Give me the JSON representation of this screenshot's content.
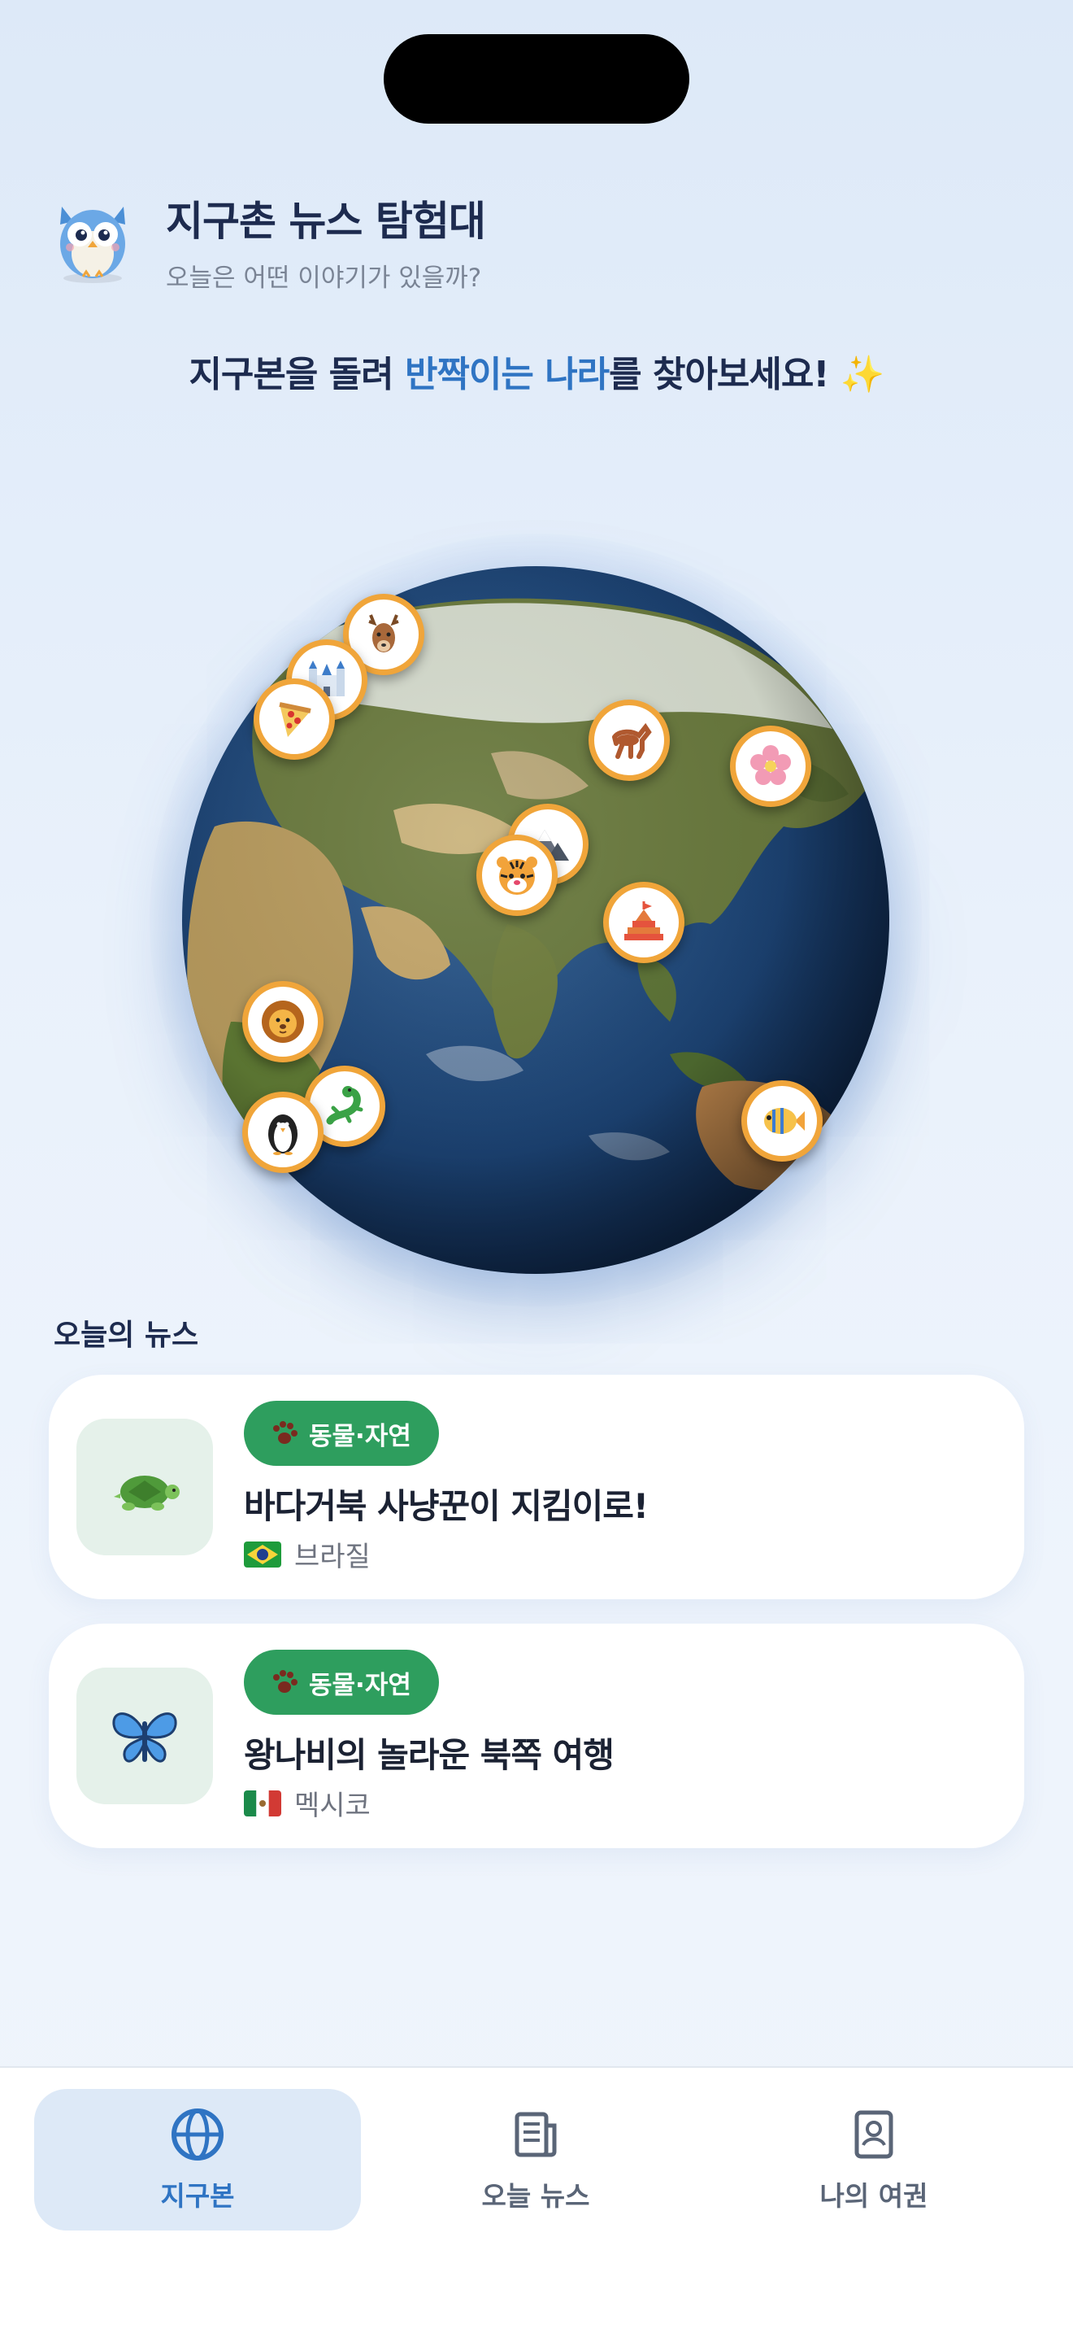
{
  "header": {
    "title": "지구촌 뉴스 탐험대",
    "subtitle": "오늘은 어떤 이야기가 있을까?"
  },
  "headline": {
    "part1": "지구본을 돌려 ",
    "highlight": "반짝이는 나라",
    "part2": "를 찾아보세요! ",
    "emoji": "✨"
  },
  "globe": {
    "markers": [
      "deer",
      "castle",
      "pizza",
      "horse",
      "cherry-blossom",
      "mountain",
      "tiger",
      "pagoda",
      "lion",
      "lizard",
      "penguin",
      "tropical-fish"
    ]
  },
  "news": {
    "section_title": "오늘의 뉴스",
    "items": [
      {
        "category": "동물·자연",
        "title": "바다거북 사냥꾼이 지킴이로!",
        "country": "브라질",
        "icon": "turtle-icon"
      },
      {
        "category": "동물·자연",
        "title": "왕나비의 놀라운 북쪽 여행",
        "country": "멕시코",
        "icon": "butterfly-icon"
      }
    ]
  },
  "tabs": [
    {
      "label": "지구본",
      "icon": "globe-icon",
      "active": true
    },
    {
      "label": "오늘 뉴스",
      "icon": "news-icon",
      "active": false
    },
    {
      "label": "나의 여권",
      "icon": "passport-icon",
      "active": false
    }
  ],
  "colors": {
    "accent": "#2f74c3",
    "badge_green": "#2e9e5e",
    "marker_ring": "#f0a53a",
    "title_navy": "#1d2b4f"
  }
}
